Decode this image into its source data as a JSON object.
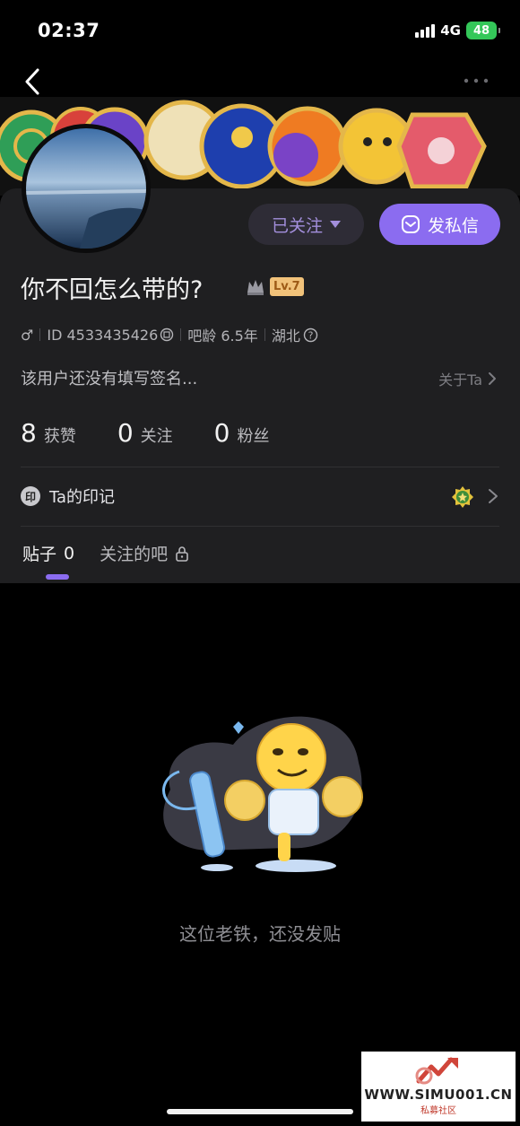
{
  "status_bar": {
    "time": "02:37",
    "network": "4G",
    "battery": "48"
  },
  "profile": {
    "username": "你不回怎么带的?",
    "level": "Lv.7",
    "gender_symbol": "♂",
    "id_text": "ID 4533435426",
    "bar_age": "吧龄 6.5年",
    "location": "湖北",
    "signature": "该用户还没有填写签名...",
    "about_link": "关于Ta"
  },
  "actions": {
    "follow_label": "已关注",
    "message_label": "发私信"
  },
  "stats": [
    {
      "value": "8",
      "label": "获赞"
    },
    {
      "value": "0",
      "label": "关注"
    },
    {
      "value": "0",
      "label": "粉丝"
    }
  ],
  "mark_row": {
    "badge": "印",
    "label": "Ta的印记"
  },
  "tabs": [
    {
      "label": "贴子",
      "count": "0"
    },
    {
      "label": "关注的吧"
    }
  ],
  "empty_state": {
    "message": "这位老铁，还没发贴"
  },
  "watermark": {
    "url": "WWW.SIMU001.CN",
    "sub": "私募社区"
  },
  "colors": {
    "accent": "#8b6cf0",
    "card": "#1f1f21",
    "background": "#000000"
  }
}
